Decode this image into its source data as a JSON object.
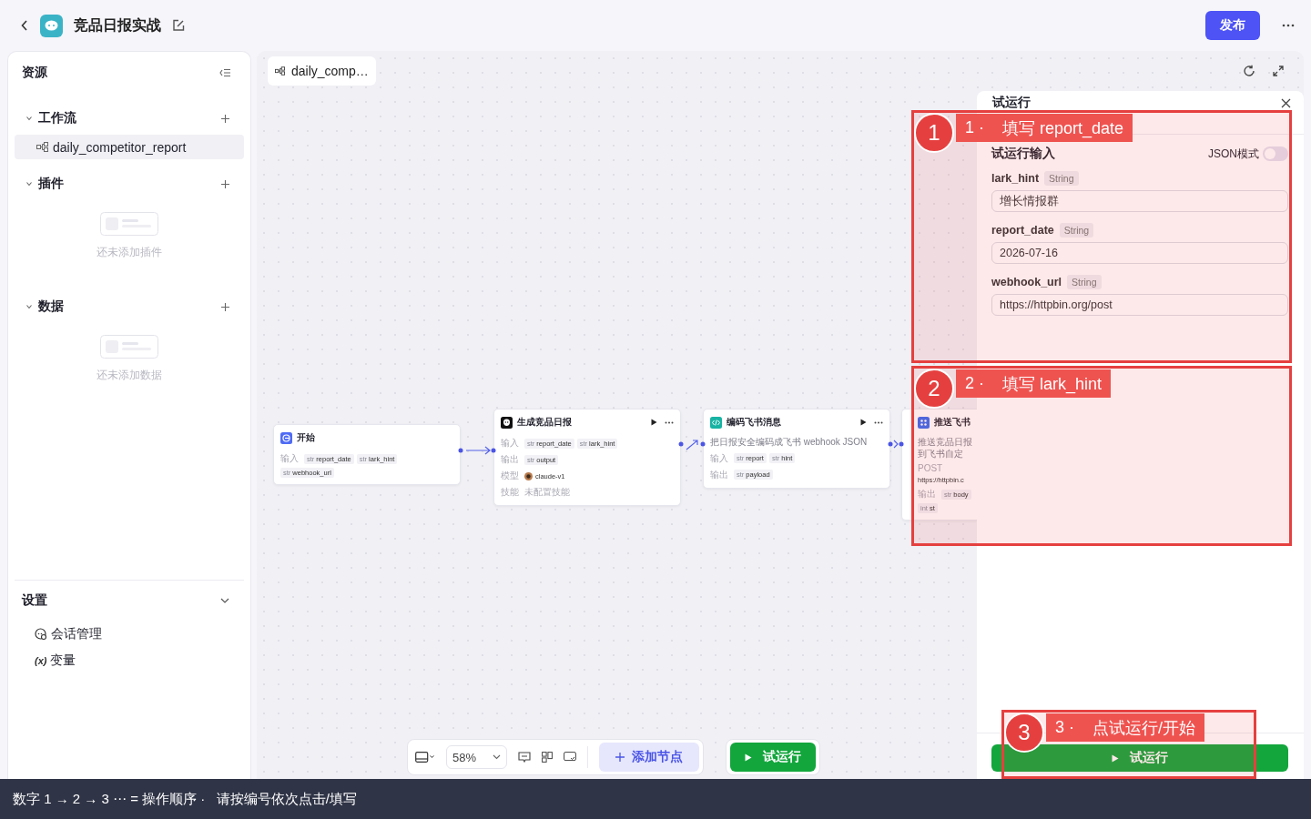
{
  "header": {
    "title": "竞品日报实战",
    "publish_button": "发布"
  },
  "sidebar": {
    "title": "资源",
    "sections": [
      {
        "kind": "workflow",
        "title": "工作流",
        "expanded": true,
        "items": [
          {
            "label": "daily_competitor_report",
            "selected": true
          }
        ]
      },
      {
        "kind": "plugin",
        "title": "插件",
        "expanded": true,
        "empty_text": "还未添加插件"
      },
      {
        "kind": "data",
        "title": "数据",
        "expanded": true,
        "empty_text": "还未添加数据"
      }
    ],
    "settings": {
      "title": "设置",
      "expanded": true,
      "items": [
        {
          "kind": "session",
          "label": "会话管理"
        },
        {
          "kind": "variable",
          "icon": "(x)",
          "label": "变量"
        }
      ]
    }
  },
  "canvas": {
    "tab": "daily_comp…",
    "nodes": [
      {
        "kind": "start",
        "title": "开始",
        "actions": false,
        "rows": [
          {
            "kind": "chips",
            "label": "输入",
            "chips": [
              {
                "type": "str",
                "name": "report_date"
              },
              {
                "type": "str",
                "name": "lark_hint"
              },
              {
                "type": "str",
                "name": "webhook_url"
              }
            ]
          }
        ]
      },
      {
        "kind": "llm",
        "title": "生成竞品日报",
        "actions": true,
        "rows": [
          {
            "kind": "chips",
            "label": "输入",
            "chips": [
              {
                "type": "str",
                "name": "report_date"
              },
              {
                "type": "str",
                "name": "lark_hint"
              }
            ]
          },
          {
            "kind": "chips",
            "label": "输出",
            "chips": [
              {
                "type": "str",
                "name": "output"
              }
            ]
          },
          {
            "kind": "model",
            "label": "模型",
            "value": "claude-v1"
          },
          {
            "kind": "text",
            "label": "技能",
            "value": "未配置技能"
          }
        ]
      },
      {
        "kind": "code",
        "title": "编码飞书消息",
        "actions": true,
        "description": "把日报安全编码成飞书 webhook JSON",
        "rows": [
          {
            "kind": "chips",
            "label": "输入",
            "chips": [
              {
                "type": "str",
                "name": "report"
              },
              {
                "type": "str",
                "name": "hint"
              }
            ]
          },
          {
            "kind": "chips",
            "label": "输出",
            "chips": [
              {
                "type": "str",
                "name": "payload"
              }
            ]
          }
        ]
      },
      {
        "kind": "http",
        "title": "推送飞书",
        "actions": false,
        "description": "推送竞品日报到飞书自定",
        "rows": [
          {
            "kind": "url",
            "label": "POST",
            "value": "https://httpbin.c"
          },
          {
            "kind": "chips",
            "label": "输出",
            "chips": [
              {
                "type": "str",
                "name": "body"
              },
              {
                "type": "int",
                "name": "st"
              }
            ]
          }
        ]
      }
    ],
    "toolbar": {
      "zoom": "58%",
      "add_node_button": "添加节点",
      "run_button": "试运行"
    }
  },
  "run_panel": {
    "title": "试运行",
    "section_title": "试运行输入",
    "json_mode": {
      "label": "JSON模式",
      "on": false
    },
    "fields": [
      {
        "name": "lark_hint",
        "type": "String",
        "value": "增长情报群"
      },
      {
        "name": "report_date",
        "type": "String",
        "value": "2026-07-16"
      },
      {
        "name": "webhook_url",
        "type": "String",
        "value": "https://httpbin.org/post"
      }
    ],
    "run_button": "试运行"
  },
  "annotations": [
    {
      "number": "1",
      "index": "1 ·",
      "text": "填写 report_date"
    },
    {
      "number": "2",
      "index": "2 ·",
      "text": "填写 lark_hint"
    },
    {
      "number": "3",
      "index": "3 ·",
      "text": "点试运行/开始"
    }
  ],
  "footer": "数字 1 → 2 → 3 ⋯ = 操作顺序 ·   请按编号依次点击/填写"
}
